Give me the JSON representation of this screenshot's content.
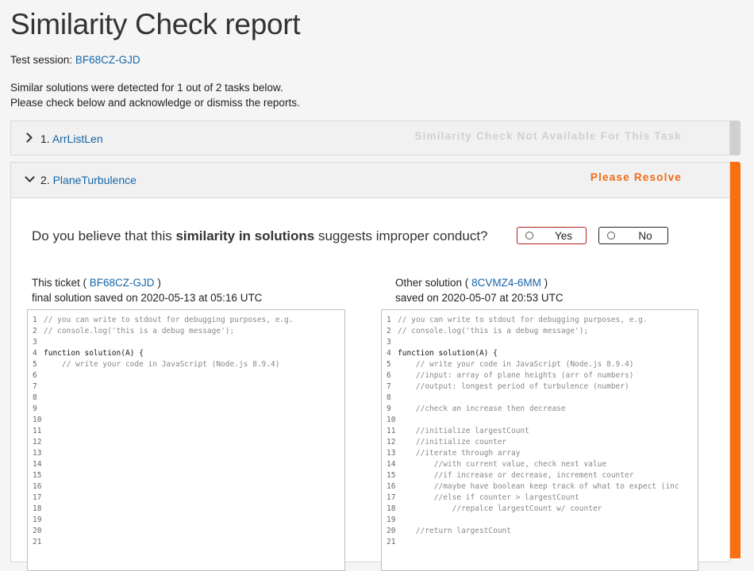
{
  "page_title": "Similarity Check report",
  "session": {
    "label": "Test session:",
    "id": "BF68CZ-GJD"
  },
  "intro": {
    "line1": "Similar solutions were detected for 1 out of 2 tasks below.",
    "line2": "Please check below and acknowledge or dismiss the reports."
  },
  "tasks": [
    {
      "number": "1.",
      "name": "ArrListLen",
      "status": "Similarity Check Not Available For This Task"
    },
    {
      "number": "2.",
      "name": "PlaneTurbulence",
      "status": "Please Resolve"
    }
  ],
  "question": {
    "pre": "Do you believe that this ",
    "bold": "similarity in solutions",
    "post": " suggests improper conduct?",
    "yes_label": "Yes",
    "no_label": "No"
  },
  "this_ticket": {
    "prefix": "This ticket (",
    "id": "BF68CZ-GJD",
    "suffix": ")",
    "saved": "final solution saved on 2020-05-13 at 05:16 UTC"
  },
  "other_solution": {
    "prefix": "Other solution (",
    "id": "8CVMZ4-6MM",
    "suffix": ")",
    "saved": "saved on 2020-05-07 at 20:53 UTC"
  },
  "colors": {
    "accent_orange": "#f96f12",
    "link_blue": "#1565a8",
    "yes_border": "#b71c1c"
  },
  "code_left": [
    "// you can write to stdout for debugging purposes, e.g.",
    "// console.log('this is a debug message');",
    "",
    "function solution(A) {",
    "    // write your code in JavaScript (Node.js 8.9.4)",
    "",
    "",
    "",
    "",
    "",
    "",
    "",
    "",
    "",
    "",
    "",
    "",
    "",
    "",
    "",
    ""
  ],
  "code_right": [
    "// you can write to stdout for debugging purposes, e.g.",
    "// console.log('this is a debug message');",
    "",
    "function solution(A) {",
    "    // write your code in JavaScript (Node.js 8.9.4)",
    "    //input: array of plane heights (arr of numbers)",
    "    //output: longest period of turbulence (number)",
    "",
    "    //check an increase then decrease",
    "",
    "    //initialize largestCount",
    "    //initialize counter",
    "    //iterate through array",
    "        //with current value, check next value",
    "        //if increase or decrease, increment counter",
    "        //maybe have boolean keep track of what to expect (inc",
    "        //else if counter > largestCount",
    "            //repalce largestCount w/ counter",
    "",
    "    //return largestCount",
    ""
  ]
}
